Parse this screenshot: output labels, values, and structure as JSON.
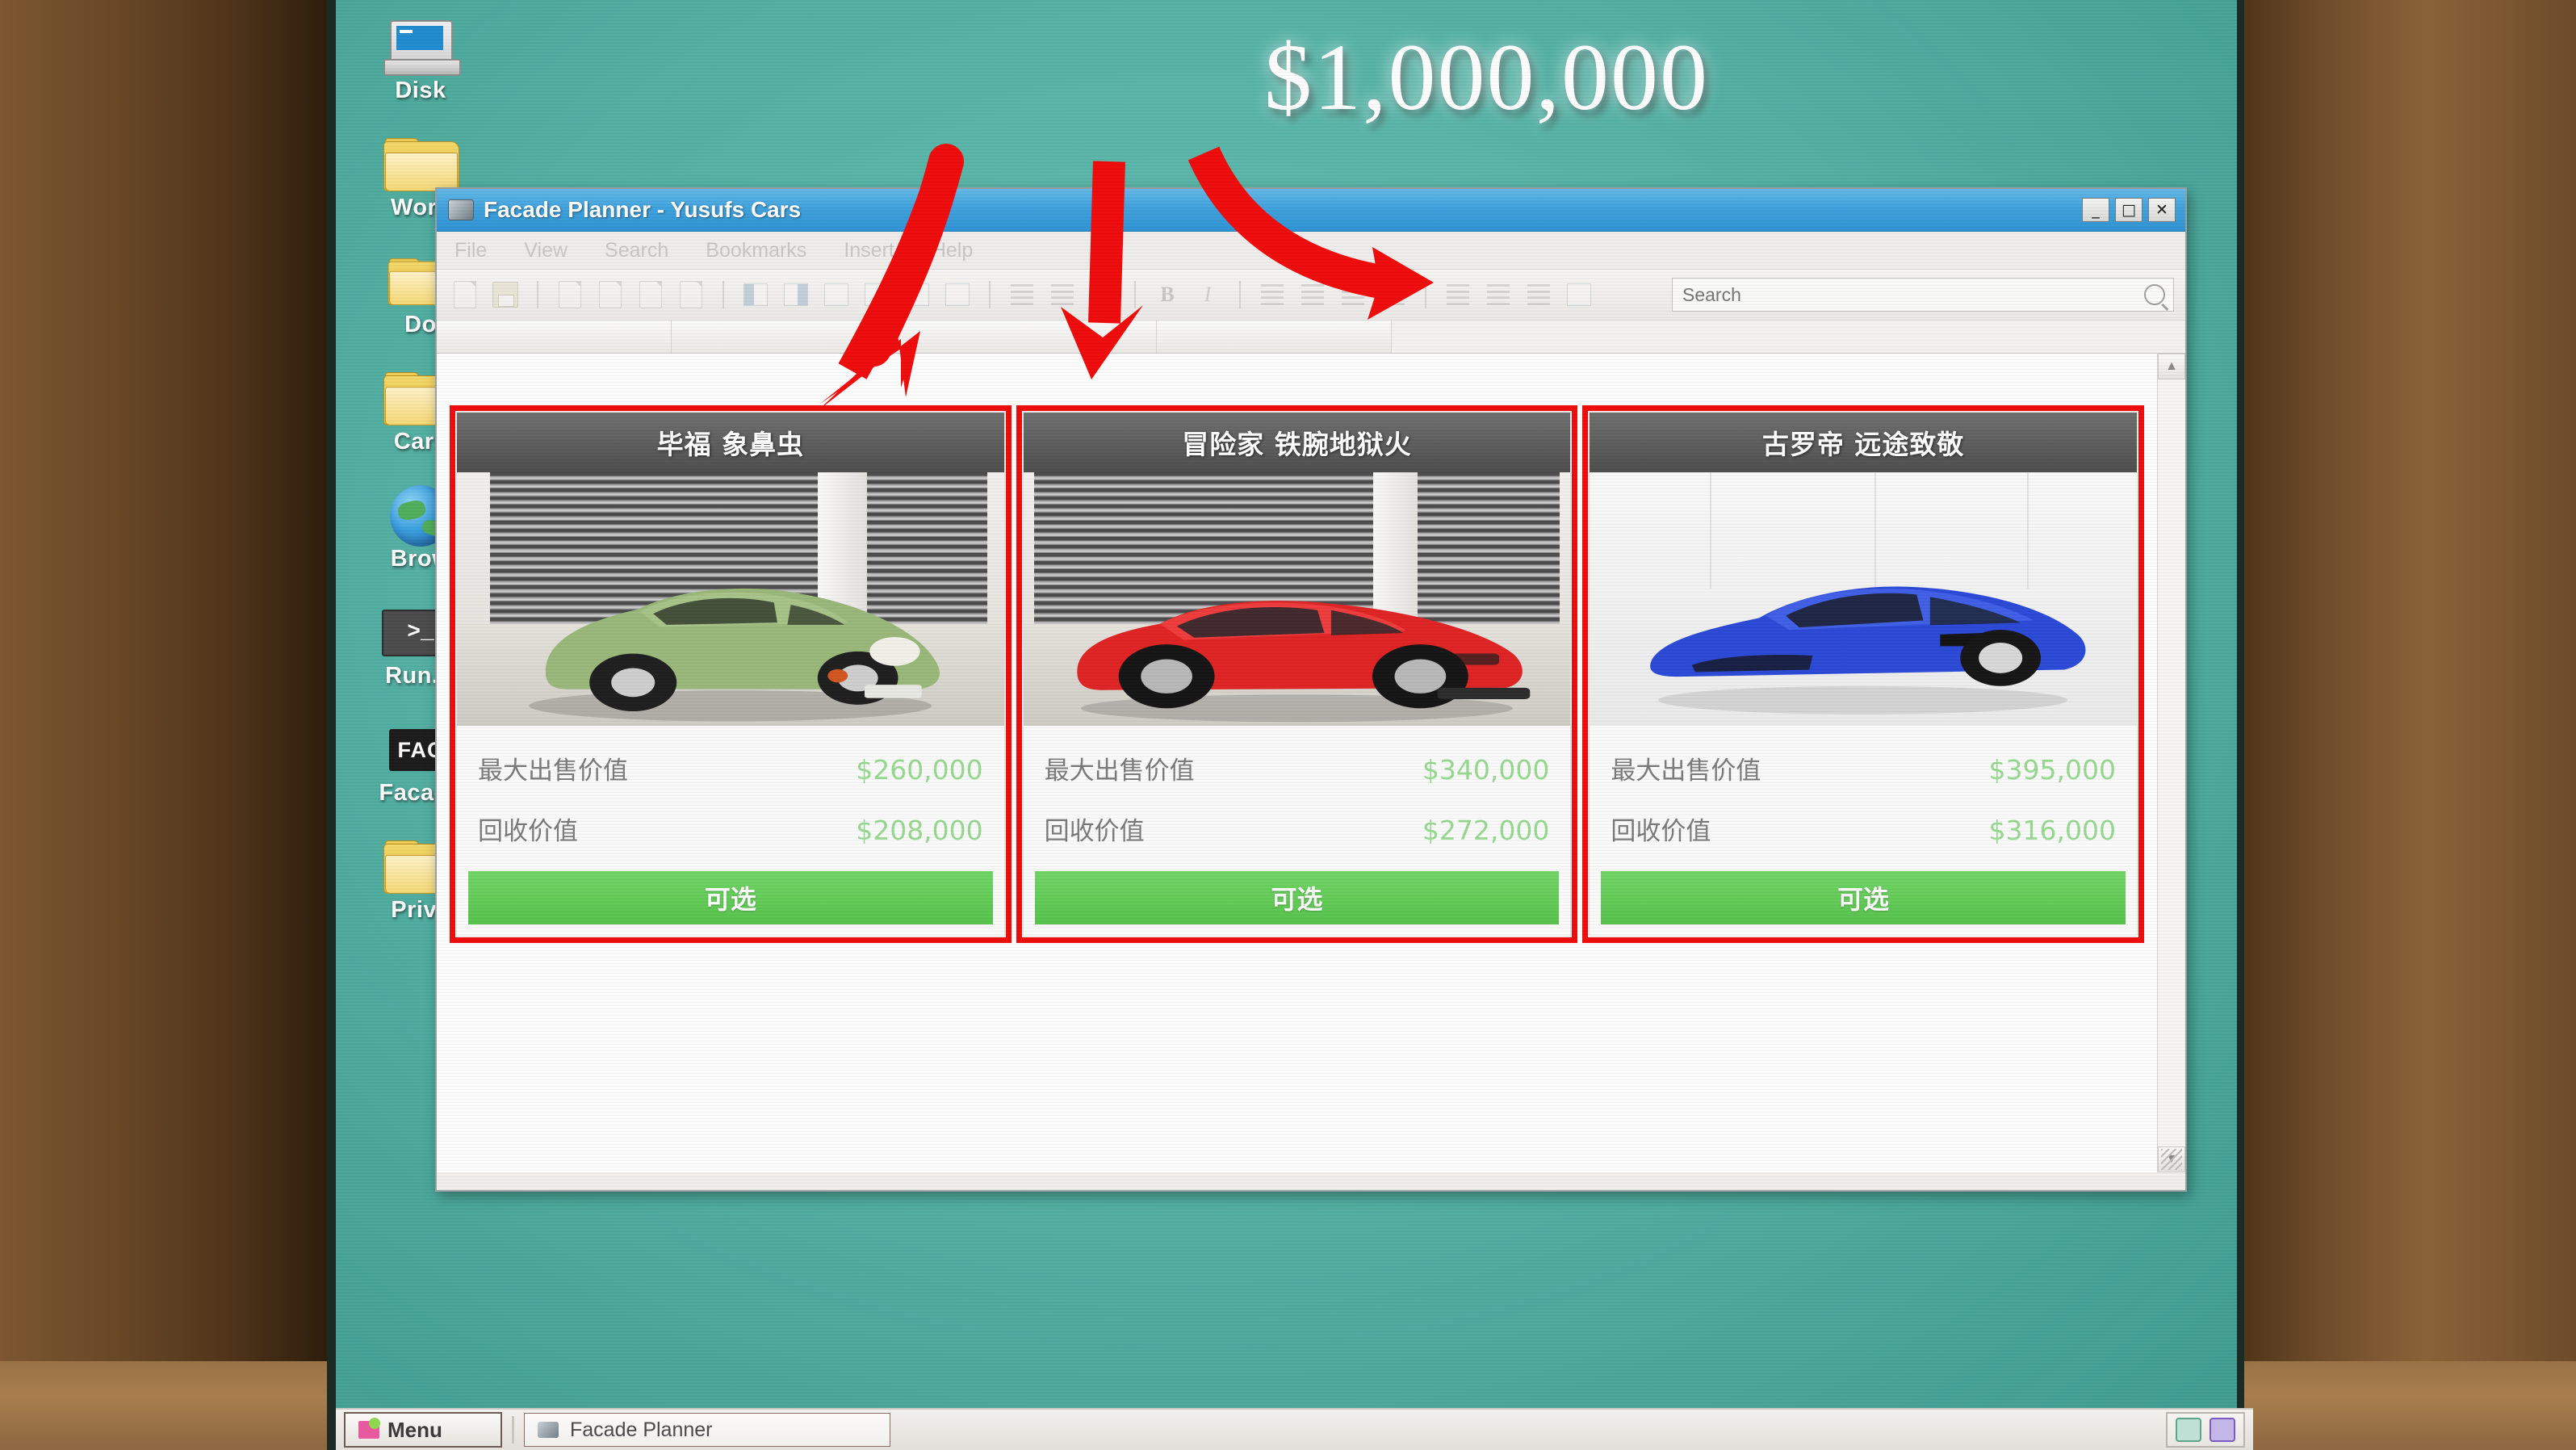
{
  "overlay": {
    "headline_price": "$1,000,000",
    "arrow_color": "#f00a0a",
    "highlight_color": "#f00a0a"
  },
  "desktop": {
    "background_color": "#56b3a6",
    "icons": [
      {
        "label": "Disk",
        "icon": "computer-icon"
      },
      {
        "label": "Work",
        "icon": "folder-icon"
      },
      {
        "label": "Do",
        "icon": "folder-icon"
      },
      {
        "label": "Cars",
        "icon": "folder-icon"
      },
      {
        "label": "Brow",
        "icon": "globe-icon"
      },
      {
        "label": "Run.C",
        "icon": "terminal-icon"
      },
      {
        "label": "Facade",
        "icon": "facade-app-icon"
      },
      {
        "label": "Priva",
        "icon": "folder-icon"
      }
    ]
  },
  "window": {
    "title": "Facade Planner - Yusufs Cars",
    "title_icon": "app-icon",
    "controls": {
      "minimize": "_",
      "maximize": "□",
      "close": "✕"
    },
    "menu": [
      "File",
      "View",
      "Search",
      "Bookmarks",
      "Insert",
      "Help"
    ],
    "search": {
      "value": "",
      "placeholder": "Search",
      "icon": "search-icon"
    },
    "accent_color": "#3fa2dd"
  },
  "cards": [
    {
      "title": "毕福 象鼻虫",
      "image": "green-beetle-car-in-garage",
      "rows": [
        {
          "label": "最大出售价值",
          "value": "$260,000"
        },
        {
          "label": "回收价值",
          "value": "$208,000"
        }
      ],
      "button": "可选",
      "highlighted": true
    },
    {
      "title": "冒险家 铁腕地狱火",
      "image": "red-muscle-car-in-garage",
      "rows": [
        {
          "label": "最大出售价值",
          "value": "$340,000"
        },
        {
          "label": "回收价值",
          "value": "$272,000"
        }
      ],
      "button": "可选",
      "highlighted": true
    },
    {
      "title": "古罗帝 远途致敬",
      "image": "blue-supercar-in-showroom",
      "rows": [
        {
          "label": "最大出售价值",
          "value": "$395,000"
        },
        {
          "label": "回收价值",
          "value": "$316,000"
        }
      ],
      "button": "可选",
      "highlighted": true
    }
  ],
  "value_color": "#96d98f",
  "button_color": "#5fcb54",
  "taskbar": {
    "menu_label": "Menu",
    "tasks": [
      {
        "label": "Facade Planner",
        "icon": "app-icon"
      }
    ],
    "tray": [
      "tray-icon-network",
      "tray-icon-volume"
    ]
  }
}
